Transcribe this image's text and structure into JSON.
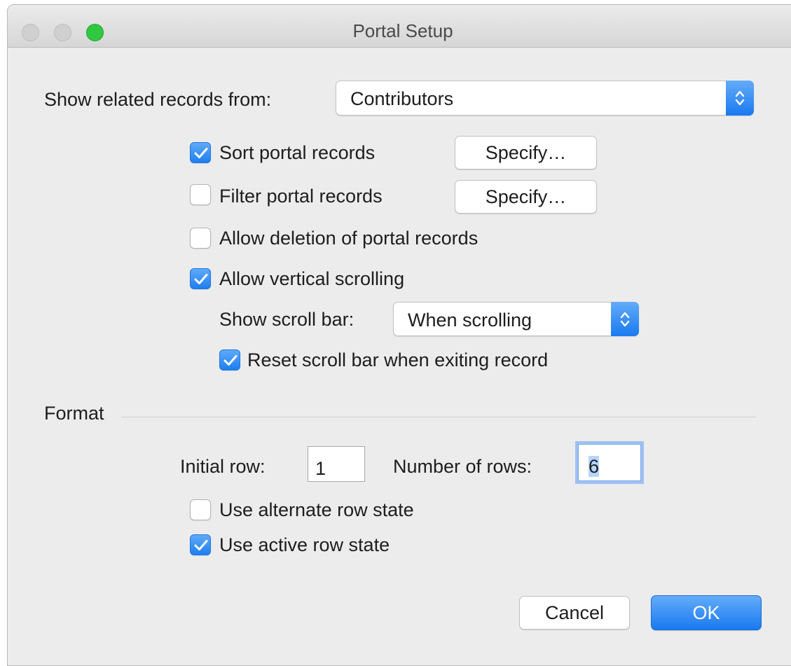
{
  "window": {
    "title": "Portal Setup"
  },
  "related": {
    "label": "Show related records from:",
    "value": "Contributors"
  },
  "sort": {
    "label": "Sort portal records",
    "checked": true,
    "button": "Specify…"
  },
  "filter": {
    "label": "Filter portal records",
    "checked": false,
    "button": "Specify…"
  },
  "allow_deletion": {
    "label": "Allow deletion of portal records",
    "checked": false
  },
  "vertical_scrolling": {
    "label": "Allow vertical scrolling",
    "checked": true
  },
  "scroll_bar": {
    "label": "Show scroll bar:",
    "value": "When scrolling"
  },
  "reset_scroll": {
    "label": "Reset scroll bar when exiting record",
    "checked": true
  },
  "format": {
    "heading": "Format",
    "initial_row_label": "Initial row:",
    "initial_row_value": "1",
    "rows_label": "Number of rows:",
    "rows_value": "6"
  },
  "alternate_row": {
    "label": "Use alternate row state",
    "checked": false
  },
  "active_row": {
    "label": "Use active row state",
    "checked": true
  },
  "buttons": {
    "cancel": "Cancel",
    "ok": "OK"
  },
  "colors": {
    "accent": "#1a79f0",
    "zoom": "#2fc840",
    "background": "#ececec"
  }
}
